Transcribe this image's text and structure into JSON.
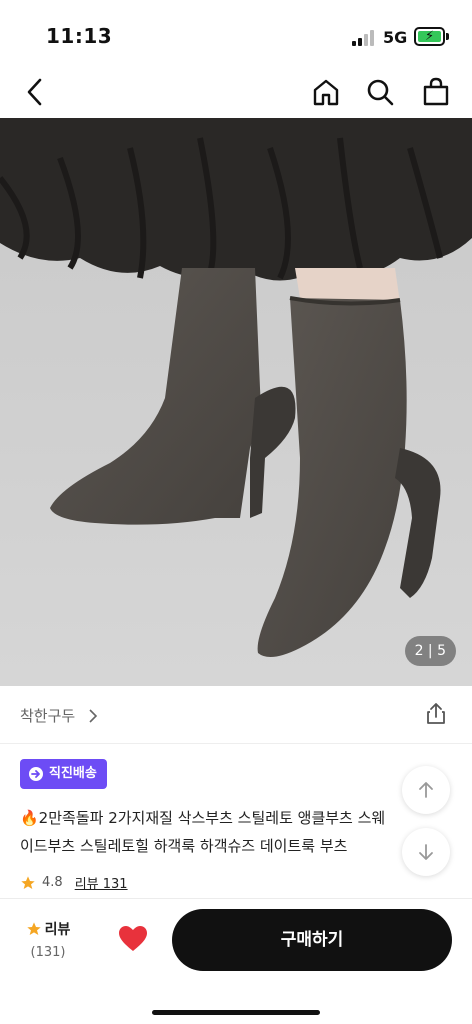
{
  "status": {
    "time": "11:13",
    "network": "5G"
  },
  "product": {
    "page_indicator": "2 | 5",
    "brand": "착한구두",
    "badge": "직진배송",
    "title_line1": "🔥2만족돌파 2가지재질 삭스부츠 스틸레토 앵클부츠 스웨",
    "title_line2": "이드부츠 스틸레토힐 하객룩 하객슈즈 데이트룩 부츠",
    "rating": "4.8",
    "review_link": "리뷰 131"
  },
  "bottom": {
    "review_label": "리뷰",
    "review_count": "(131)",
    "buy_label": "구매하기"
  },
  "colors": {
    "badge": "#6d4cf5",
    "star": "#f5a623",
    "heart": "#e8323c",
    "button": "#111111"
  },
  "icons": [
    "back-icon",
    "home-icon",
    "search-icon",
    "bag-icon",
    "share-icon",
    "chevron-right-icon",
    "arrow-up-icon",
    "arrow-down-icon",
    "star-icon",
    "heart-icon"
  ]
}
